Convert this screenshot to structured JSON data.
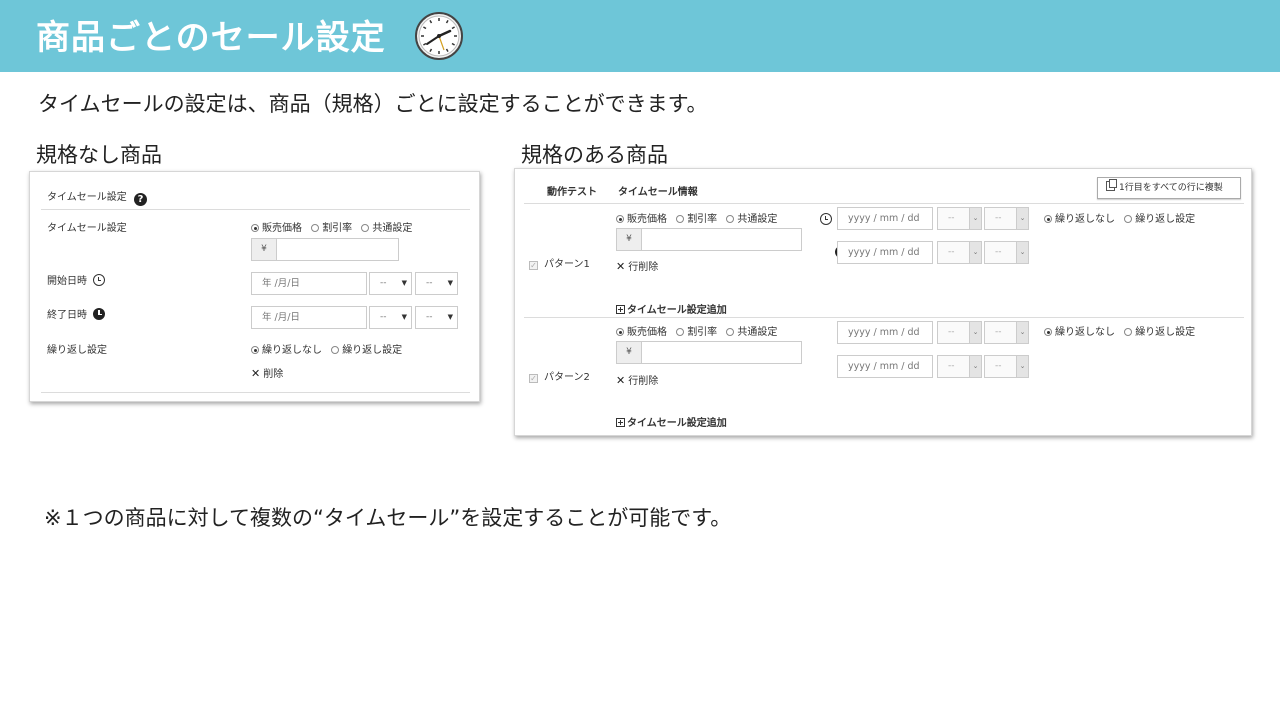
{
  "header": {
    "title": "商品ごとのセール設定",
    "icon": "clock-icon",
    "bg_color": "#6ec6d8"
  },
  "intro": "タイムセールの設定は、商品（規格）ごとに設定することができます。",
  "left_label": "規格なし商品",
  "right_label": "規格のある商品",
  "footnote": "※１つの商品に対して複数の“タイムセール”を設定することが可能です。",
  "panel1": {
    "title": "タイムセール設定",
    "row_sale": {
      "label": "タイムセール設定",
      "options": [
        "販売価格",
        "割引率",
        "共通設定"
      ],
      "selected": "販売価格",
      "yen": "¥",
      "amount": ""
    },
    "row_start": {
      "label": "開始日時",
      "date_placeholder": "年 /月/日",
      "hour": "--",
      "minute": "--"
    },
    "row_end": {
      "label": "終了日時",
      "date_placeholder": "年 /月/日",
      "hour": "--",
      "minute": "--"
    },
    "row_repeat": {
      "label": "繰り返し設定",
      "options": [
        "繰り返しなし",
        "繰り返し設定"
      ],
      "selected": "繰り返しなし"
    },
    "delete_label": "削除"
  },
  "panel2": {
    "col_test": "動作テスト",
    "col_info": "タイムセール情報",
    "copy_button": "1行目をすべての行に複製",
    "patterns": [
      {
        "name": "パターン1",
        "options": [
          "販売価格",
          "割引率",
          "共通設定"
        ],
        "selected": "販売価格",
        "yen": "¥",
        "date_placeholder": "yyyy / mm / dd",
        "hour": "--",
        "minute": "--",
        "repeat_options": [
          "繰り返しなし",
          "繰り返し設定"
        ],
        "repeat_selected": "繰り返しなし",
        "delete_row": "行削除",
        "add_label": "タイムセール設定追加"
      },
      {
        "name": "パターン2",
        "options": [
          "販売価格",
          "割引率",
          "共通設定"
        ],
        "selected": "販売価格",
        "yen": "¥",
        "date_placeholder": "yyyy / mm / dd",
        "hour": "--",
        "minute": "--",
        "repeat_options": [
          "繰り返しなし",
          "繰り返し設定"
        ],
        "repeat_selected": "繰り返しなし",
        "delete_row": "行削除",
        "add_label": "タイムセール設定追加"
      }
    ]
  }
}
